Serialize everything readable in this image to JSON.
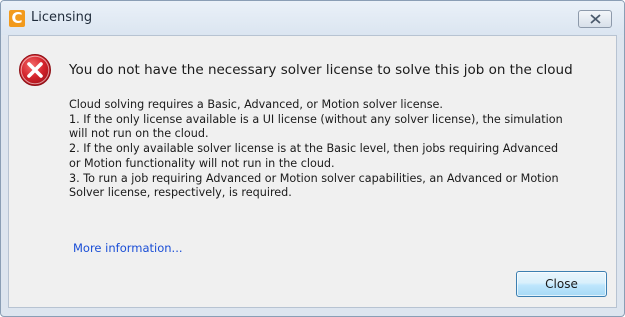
{
  "window": {
    "title": "Licensing",
    "app_icon_letter": "C",
    "icons": {
      "app": "app-logo-icon",
      "close": "close-icon",
      "error": "error-icon"
    }
  },
  "dialog": {
    "headline": "You do not have the necessary solver license to solve this job on the cloud",
    "body_lines": [
      "Cloud solving requires a Basic, Advanced, or Motion solver license.",
      "1. If the only license available is a UI license (without any solver license), the simulation",
      "will not run on the cloud.",
      " 2. If the only available solver license is  at the Basic level, then jobs requiring Advanced",
      "or Motion functionality will not run in the cloud.",
      "3. To run a job requiring Advanced or Motion solver capabilities,  an Advanced or Motion",
      "Solver license, respectively,  is required."
    ],
    "more_info_link": "More information...",
    "close_button_label": "Close"
  },
  "colors": {
    "link": "#1a4ed6",
    "error_red": "#d4242c",
    "button_border": "#3c7fb1",
    "app_icon": "#f29a1c"
  }
}
